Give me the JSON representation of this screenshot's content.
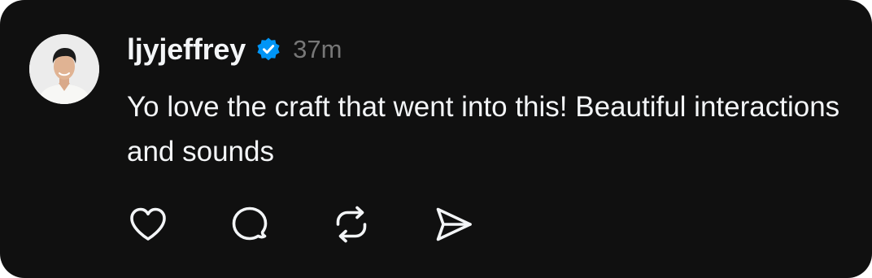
{
  "post": {
    "username": "ljyjeffrey",
    "verified": true,
    "timestamp": "37m",
    "text": "Yo love the craft that went into this! Beautiful interactions and sounds"
  },
  "icons": {
    "avatar": "user-avatar-photo",
    "verified": "verified-badge-icon",
    "like": "heart-icon",
    "reply": "comment-bubble-icon",
    "repost": "repost-arrows-icon",
    "share": "paper-plane-send-icon"
  },
  "colors": {
    "background": "#101010",
    "text": "#f3f5f7",
    "muted": "#777777",
    "verified_badge": "#0095f6"
  }
}
